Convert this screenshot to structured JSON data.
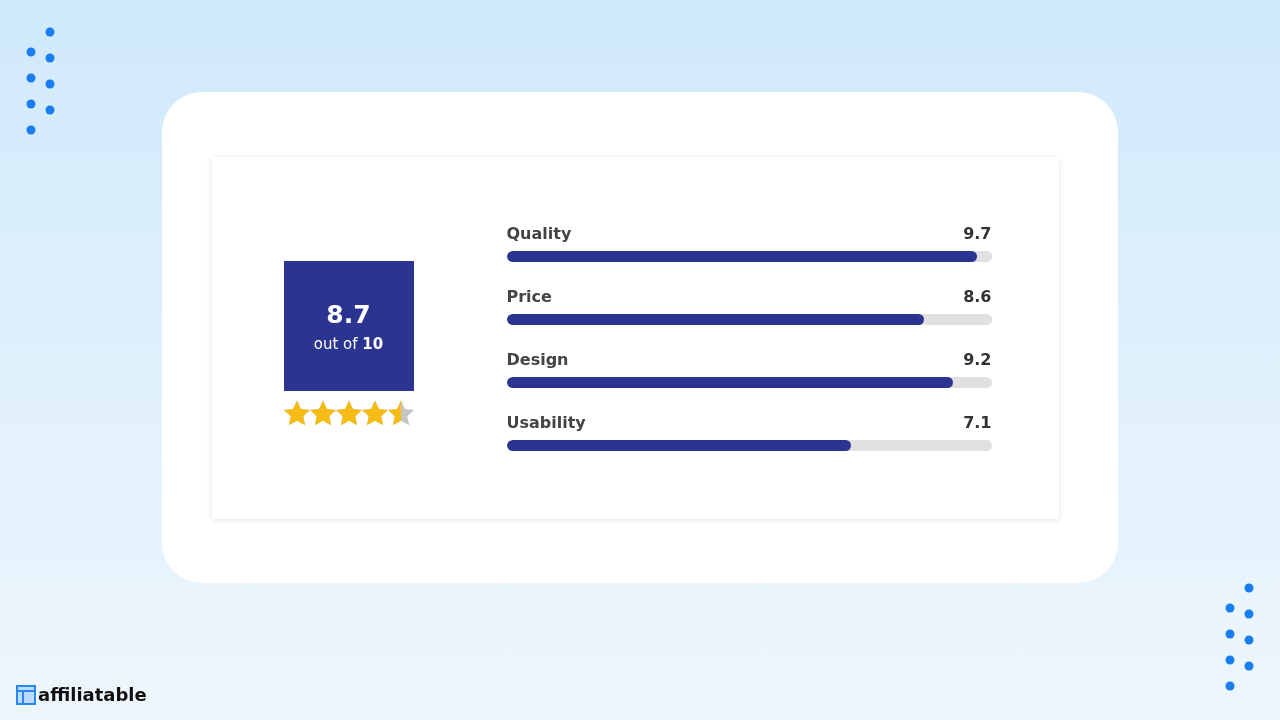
{
  "rating": {
    "score": "8.7",
    "out_of": "out of **10**",
    "stars": 4.5
  },
  "criteria": [
    {
      "label": "Quality",
      "value": "9.7",
      "level": 0.97
    },
    {
      "label": "Price",
      "value": "8.6",
      "level": 0.86
    },
    {
      "label": "Design",
      "value": "9.2",
      "level": 0.92
    },
    {
      "label": "Usability",
      "value": "7.1",
      "level": 0.71
    }
  ],
  "brand": {
    "name": "affiliatable"
  }
}
